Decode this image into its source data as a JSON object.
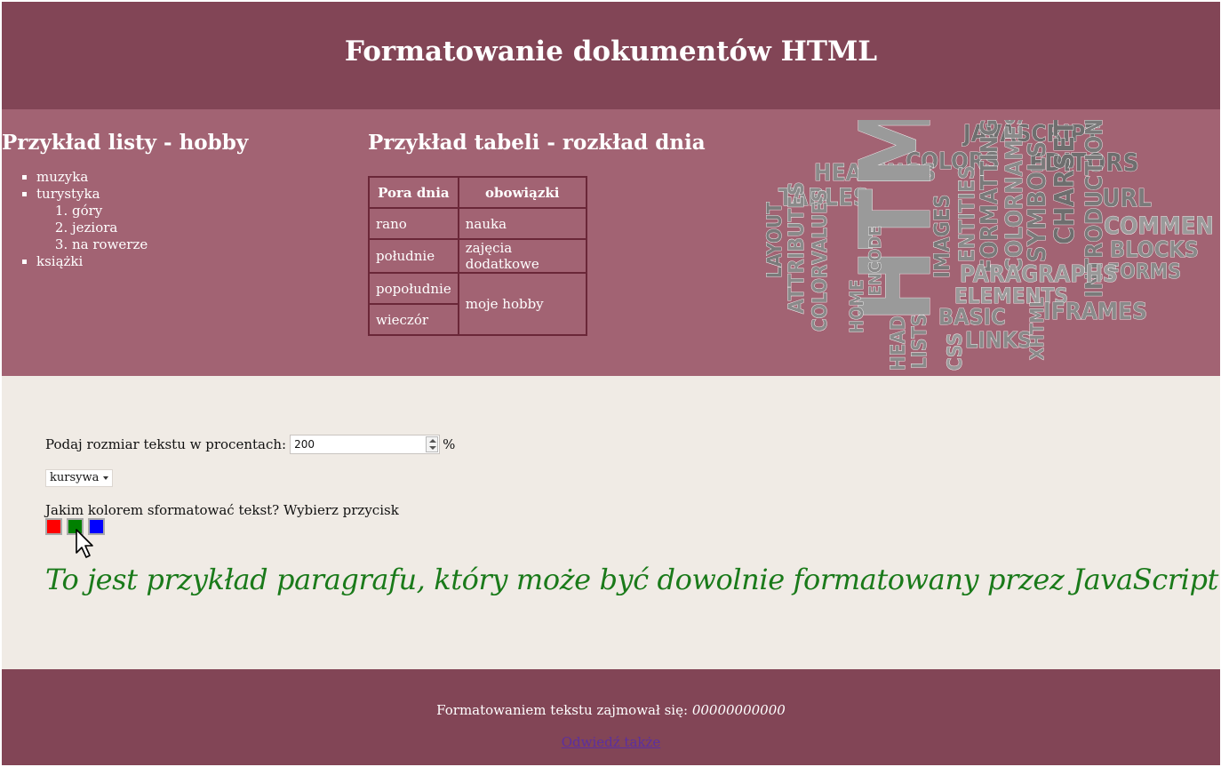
{
  "header": {
    "title": "Formatowanie dokumentów HTML"
  },
  "hobby": {
    "heading": "Przykład listy - hobby",
    "items": [
      "muzyka",
      "turystyka",
      "książki"
    ],
    "sub_items": [
      "góry",
      "jeziora",
      "na rowerze"
    ]
  },
  "schedule": {
    "heading": "Przykład tabeli - rozkład dnia",
    "headers": [
      "Pora dnia",
      "obowiązki"
    ],
    "rows": [
      [
        "rano",
        "nauka"
      ],
      [
        "południe",
        "zajęcia dodatkowe"
      ],
      [
        "popołudnie",
        "moje hobby"
      ],
      [
        "wieczór",
        ""
      ]
    ]
  },
  "word_cloud": {
    "words": [
      "JAVASCRIPT",
      "COLORS",
      "EDITORS",
      "HEADINGS",
      "TABLES",
      "URL",
      "HTML",
      "FORMATTING",
      "COLORNAMES",
      "SYMBOLS",
      "CHARSET",
      "INTRODUCTION",
      "COMMENTS",
      "BLOCKS",
      "FORMS",
      "LAYOUT",
      "ATTRIBUTES",
      "COLORVALUES",
      "HOME",
      "ENCODE",
      "ENTITIES",
      "IMAGES",
      "PARAGRAPHS",
      "ELEMENTS",
      "BASIC",
      "IFRAMES",
      "LINKS",
      "CSS",
      "HEAD",
      "LISTS",
      "XHTML"
    ]
  },
  "form": {
    "size_label": "Podaj rozmiar tekstu w procentach:",
    "size_value": "200",
    "size_unit": "%",
    "style_selected": "kursywa",
    "color_question": "Jakim kolorem sformatować tekst? Wybierz przycisk",
    "colors": {
      "red": "#ff0000",
      "green": "#008000",
      "blue": "#0000ff"
    }
  },
  "demo": {
    "text": "To jest przykład paragrafu, który może być dowolnie formatowany przez JavaScript",
    "color": "#1a7a1a"
  },
  "footer": {
    "credit_label": "Formatowaniem tekstu zajmował się:",
    "credit_name": "00000000000",
    "link_text": "Odwiedź także"
  },
  "theme": {
    "dark": "#824556",
    "mid": "#a26373",
    "light": "#f0ebe5"
  }
}
